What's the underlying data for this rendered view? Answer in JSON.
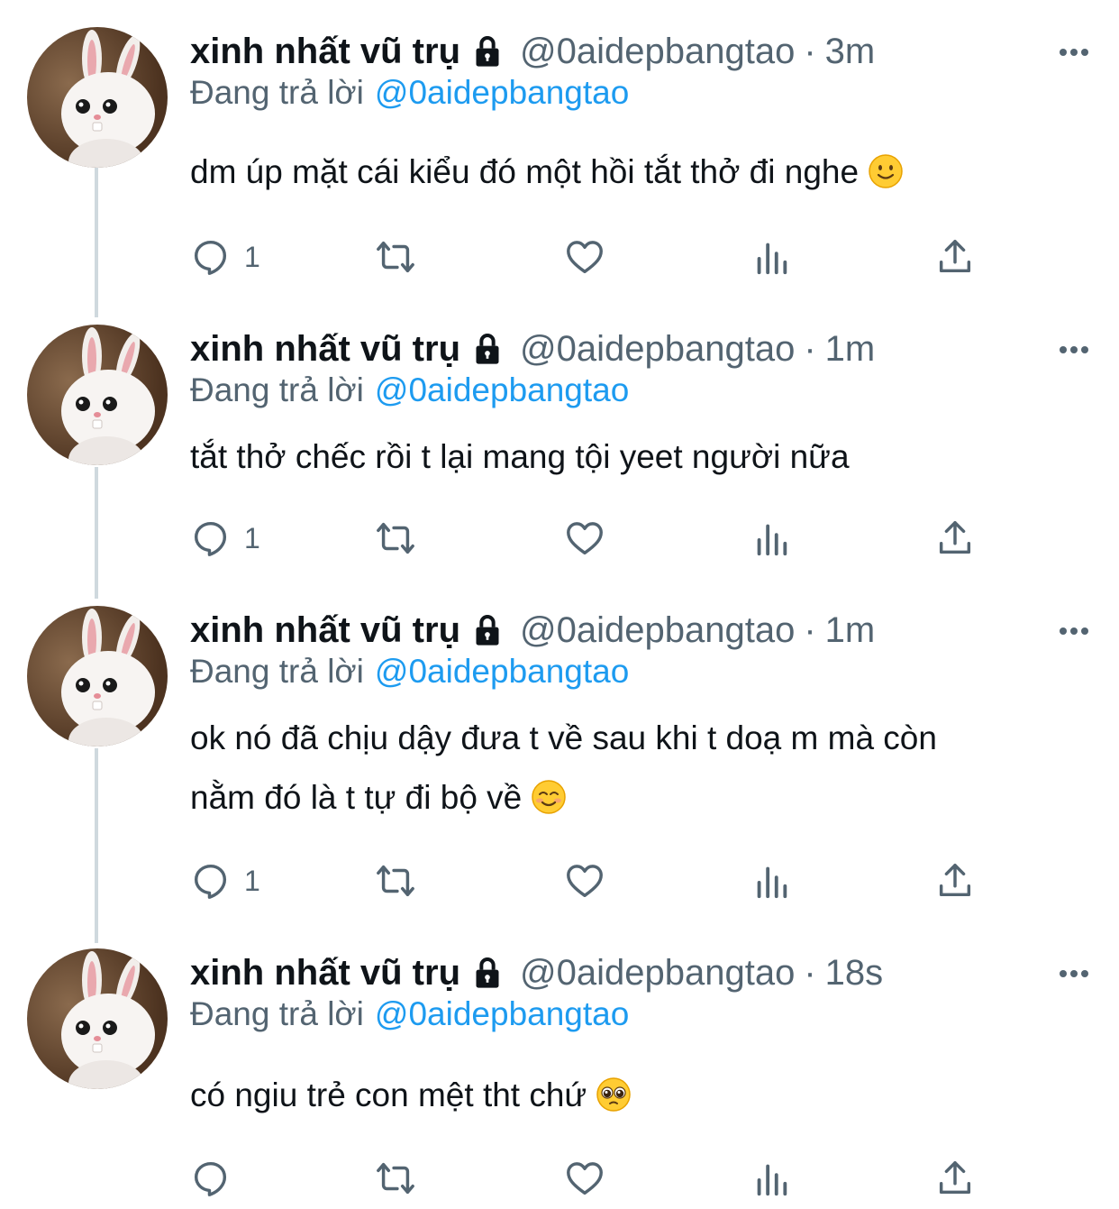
{
  "tweets": [
    {
      "name": "xinh nhất vũ trụ",
      "handle": "@0aidepbangtao",
      "separator": "·",
      "time": "3m",
      "reply_prefix": "Đang trả lời",
      "reply_handle": "@0aidepbangtao",
      "text": "dm úp mặt cái kiểu đó một hồi tắt thở đi nghe",
      "emoji": "slightly-smiling-face",
      "reply_count": "1"
    },
    {
      "name": "xinh nhất vũ trụ",
      "handle": "@0aidepbangtao",
      "separator": "·",
      "time": "1m",
      "reply_prefix": "Đang trả lời",
      "reply_handle": "@0aidepbangtao",
      "text": "tắt thở chếc rồi t lại mang tội yeet người nữa",
      "emoji": "",
      "reply_count": "1"
    },
    {
      "name": "xinh nhất vũ trụ",
      "handle": "@0aidepbangtao",
      "separator": "·",
      "time": "1m",
      "reply_prefix": "Đang trả lời",
      "reply_handle": "@0aidepbangtao",
      "text_line1": "ok nó đã chịu dậy đưa t về sau khi t doạ m mà còn",
      "text_line2": "nằm đó là t tự đi bộ về",
      "emoji": "smiling-face",
      "reply_count": "1"
    },
    {
      "name": "xinh nhất vũ trụ",
      "handle": "@0aidepbangtao",
      "separator": "·",
      "time": "18s",
      "reply_prefix": "Đang trả lời",
      "reply_handle": "@0aidepbangtao",
      "text": "có ngiu trẻ con mệt tht chứ",
      "emoji": "pleading-face",
      "reply_count": ""
    }
  ],
  "icons": {
    "lock": "lock-icon",
    "more": "more-icon",
    "reply": "reply-icon",
    "retweet": "retweet-icon",
    "like": "heart-icon",
    "views": "views-icon",
    "share": "share-icon"
  },
  "colors": {
    "text": "#0f1419",
    "muted": "#536471",
    "link": "#1d9bf0",
    "thread_line": "#cfd9de",
    "background": "#ffffff"
  }
}
